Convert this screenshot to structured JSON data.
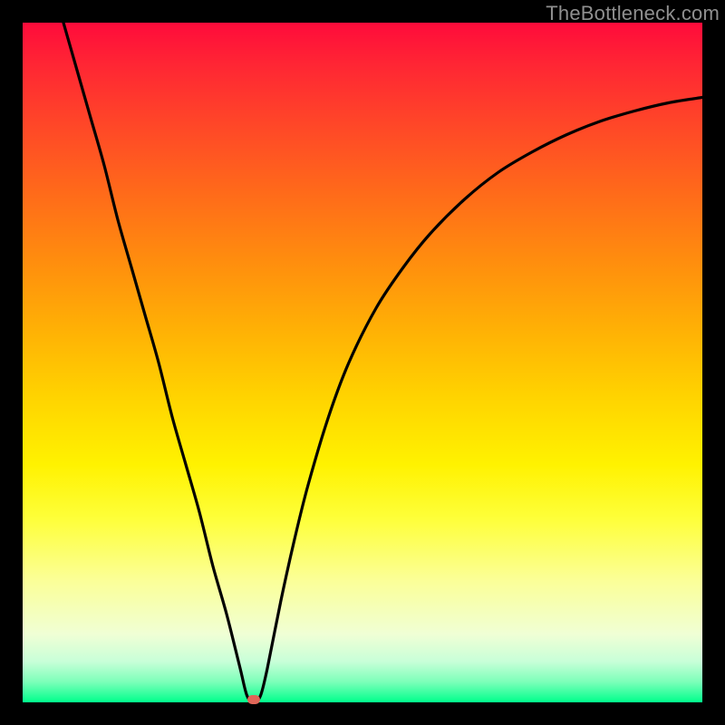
{
  "watermark": "TheBottleneck.com",
  "chart_data": {
    "type": "line",
    "title": "",
    "xlabel": "",
    "ylabel": "",
    "xlim": [
      0,
      100
    ],
    "ylim": [
      0,
      100
    ],
    "series": [
      {
        "name": "curve",
        "x": [
          6,
          8,
          10,
          12,
          14,
          16,
          18,
          20,
          22,
          24,
          26,
          28,
          30,
          32,
          33,
          34,
          35,
          36,
          38,
          40,
          42,
          45,
          48,
          52,
          56,
          60,
          65,
          70,
          75,
          80,
          85,
          90,
          95,
          100
        ],
        "values": [
          100,
          93,
          86,
          79,
          71,
          64,
          57,
          50,
          42,
          35,
          28,
          20,
          13,
          5,
          1,
          0,
          1,
          5,
          15,
          24,
          32,
          42,
          50,
          58,
          64,
          69,
          74,
          78,
          81,
          83.5,
          85.5,
          87,
          88.2,
          89
        ]
      }
    ],
    "marker": {
      "x": 34,
      "y": 0.4,
      "color": "#e06658"
    },
    "gradient_stops": [
      {
        "pos": 0,
        "color": "#ff0b3b"
      },
      {
        "pos": 50,
        "color": "#ffd300"
      },
      {
        "pos": 80,
        "color": "#fbff97"
      },
      {
        "pos": 100,
        "color": "#00ff8c"
      }
    ]
  }
}
